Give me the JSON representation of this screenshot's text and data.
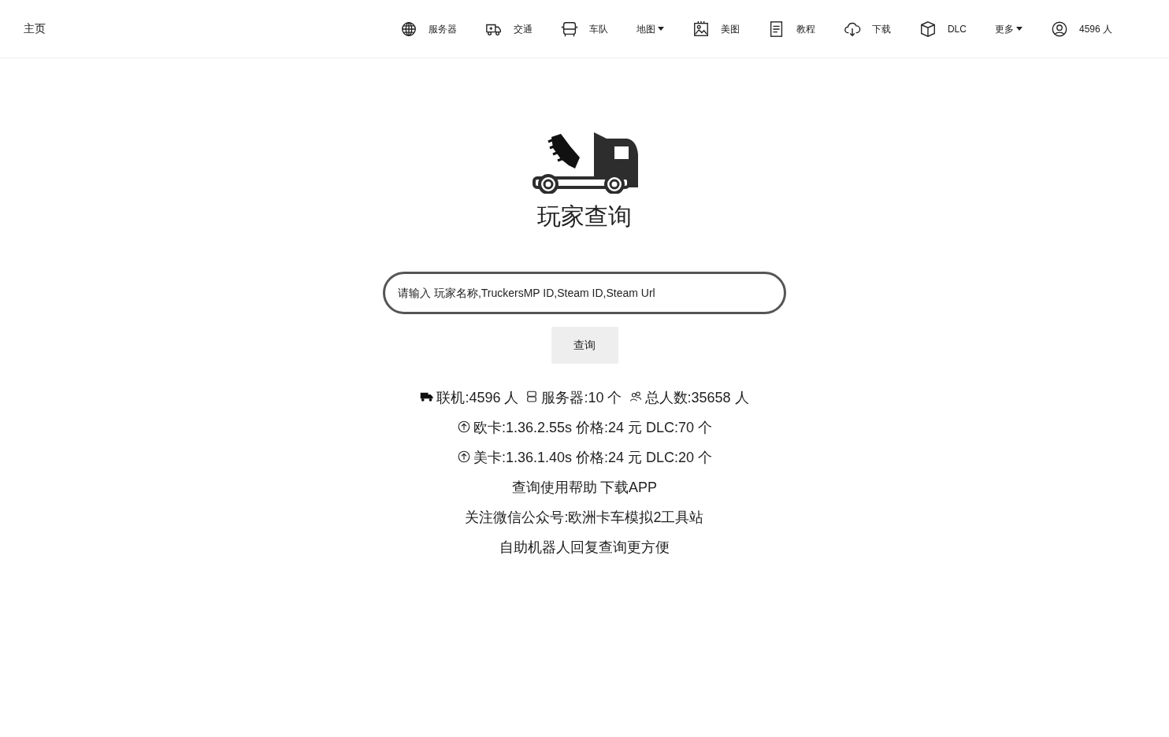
{
  "navbar": {
    "brand": "主页",
    "items": [
      {
        "kind": "link",
        "label": "服务器"
      },
      {
        "kind": "link",
        "label": "交通"
      },
      {
        "kind": "link",
        "label": "车队"
      },
      {
        "kind": "dropdown",
        "label": "地图"
      },
      {
        "kind": "link",
        "label": "美图"
      },
      {
        "kind": "link",
        "label": "教程"
      },
      {
        "kind": "link",
        "label": "下载"
      },
      {
        "kind": "link",
        "label": "DLC"
      },
      {
        "kind": "dropdown",
        "label": "更多"
      },
      {
        "kind": "link",
        "label": "4596 人"
      }
    ]
  },
  "hero": {
    "title": "玩家查询"
  },
  "search": {
    "placeholder": "请输入 玩家名称,TruckersMP ID,Steam ID,Steam Url",
    "button": "查询"
  },
  "stats": [
    {
      "text": "联机:4596 人"
    },
    {
      "text": "服务器:10 个"
    },
    {
      "text": "总人数:35658 人"
    }
  ],
  "versions": [
    {
      "text": "欧卡:1.36.2.55s 价格:24 元 DLC:70 个"
    },
    {
      "text": "美卡:1.36.1.40s 价格:24 元 DLC:20 个"
    }
  ],
  "links": [
    "查询使用帮助",
    "下载APP"
  ],
  "notes": [
    "关注微信公众号:欧洲卡车模拟2工具站",
    "自助机器人回复查询更方便"
  ]
}
